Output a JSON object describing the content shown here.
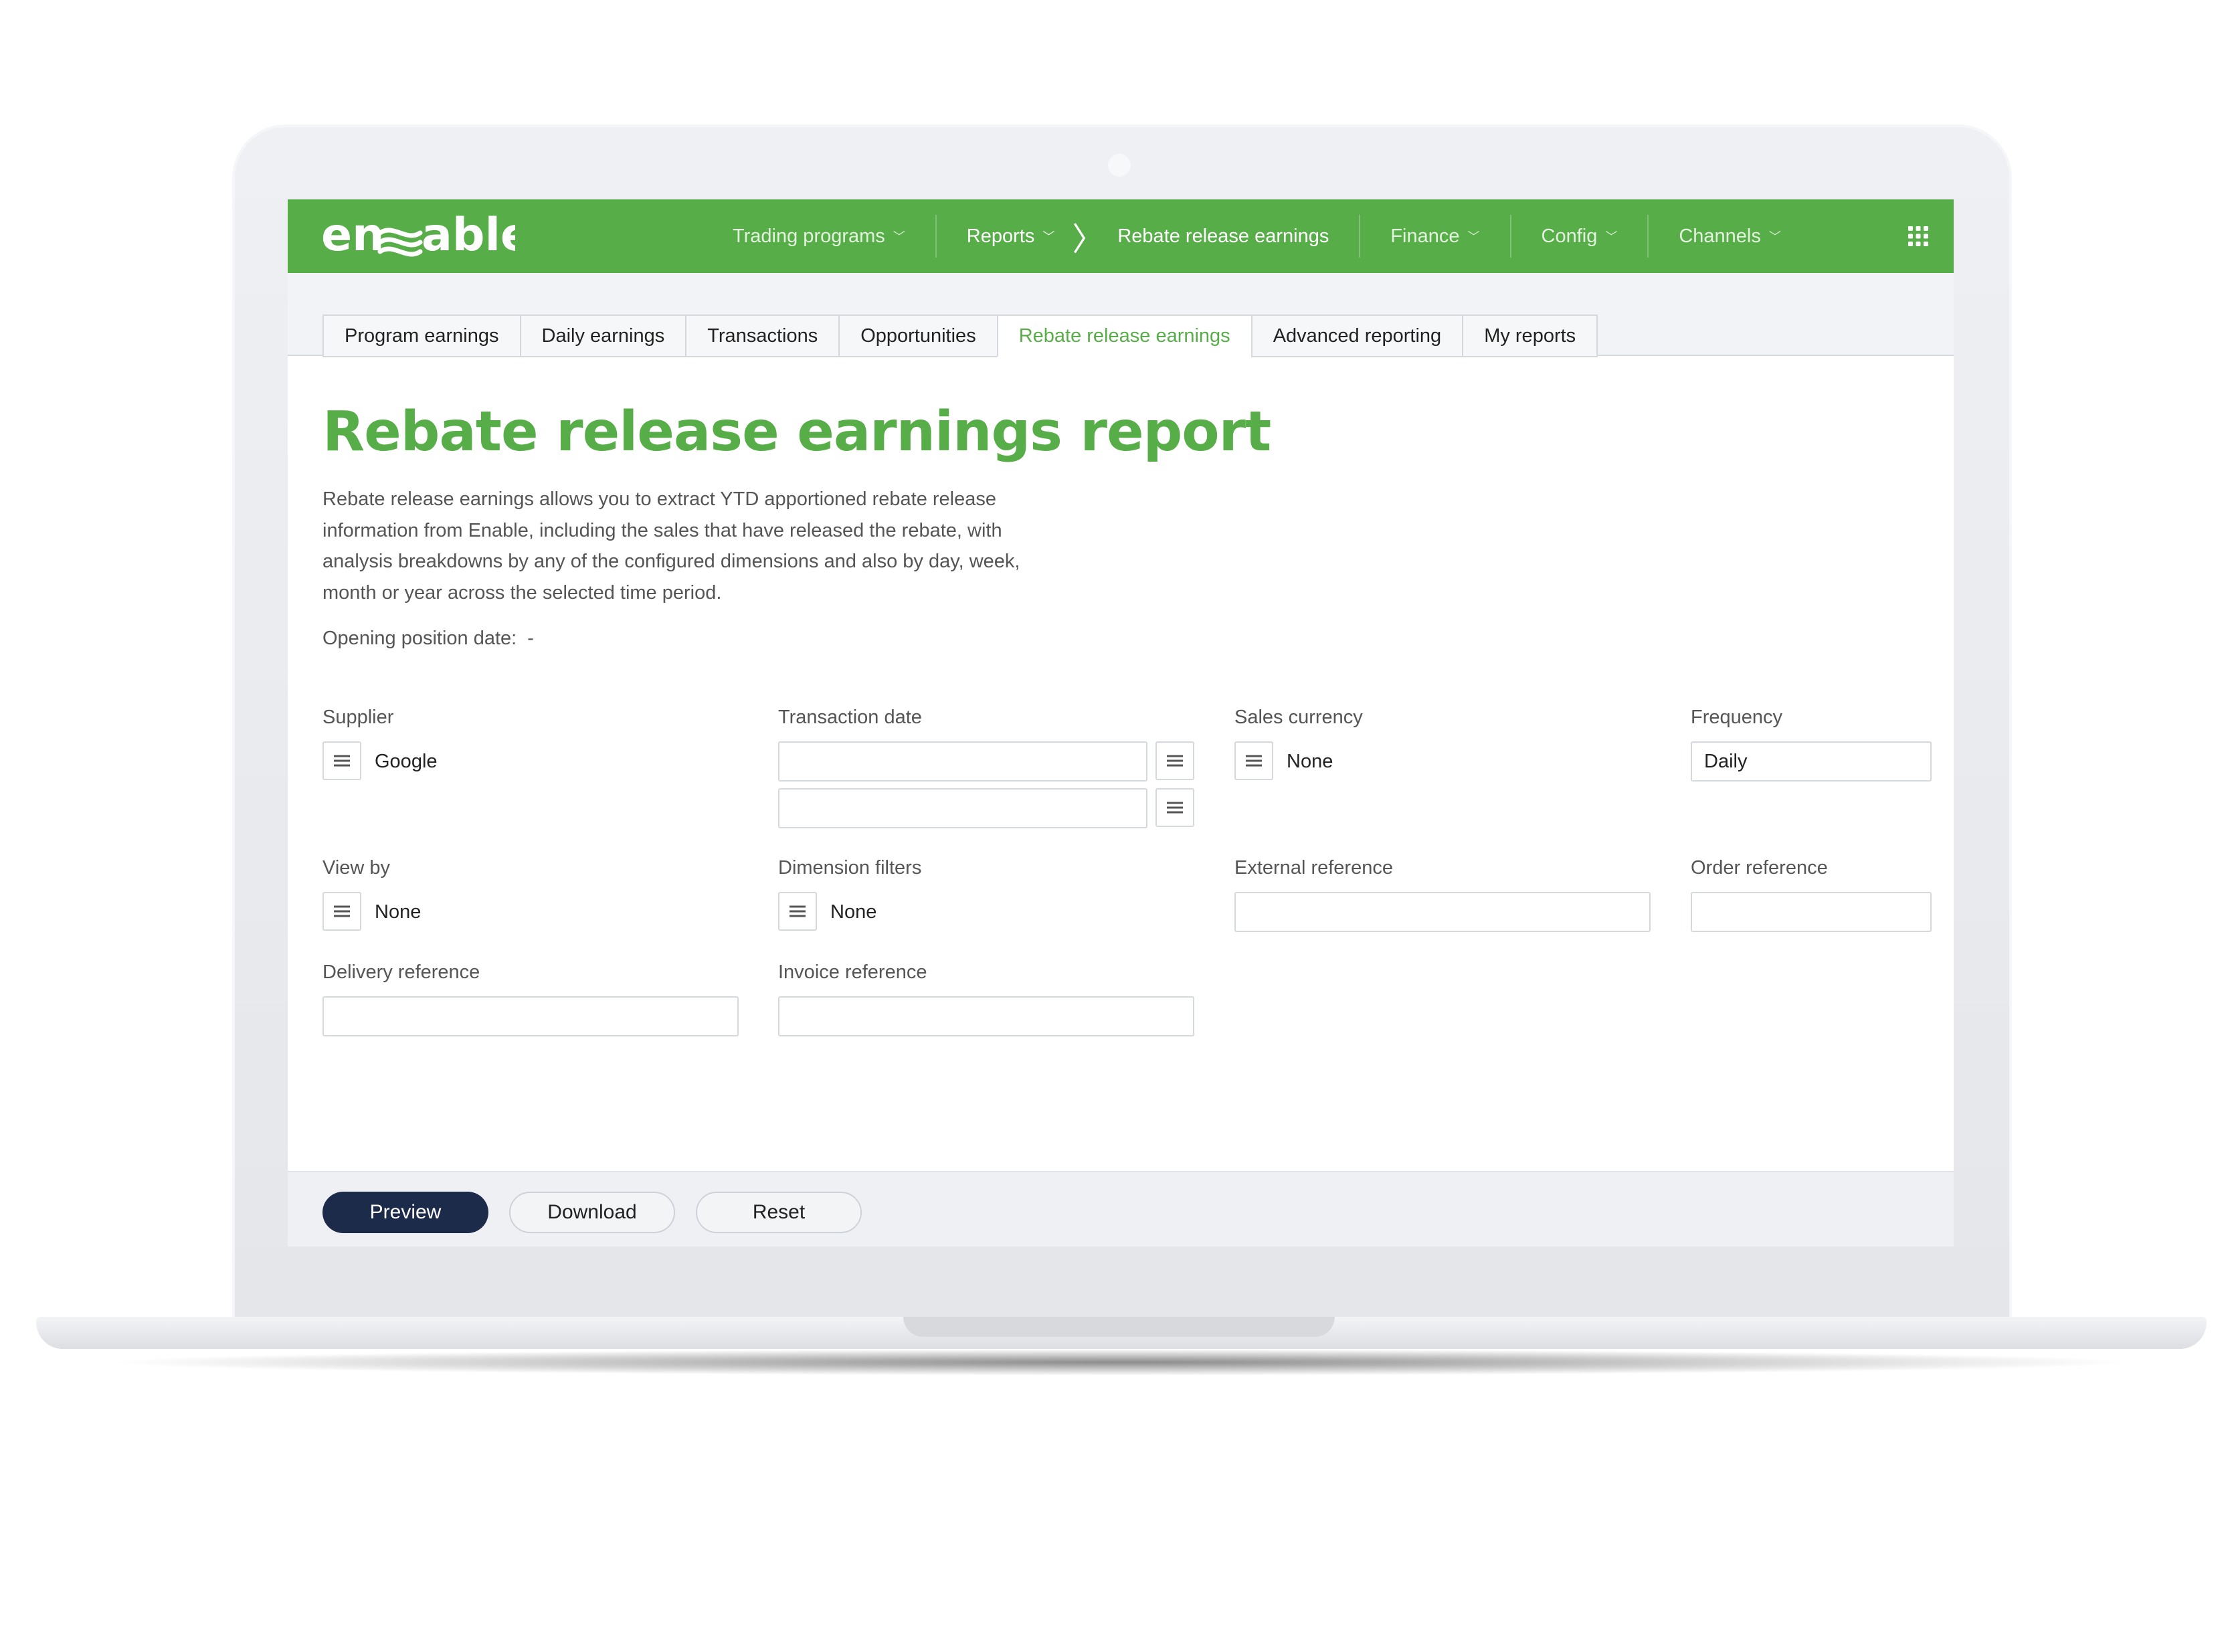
{
  "app": {
    "logo_text": "enable",
    "colors": {
      "brand_green": "#57ad47",
      "primary_button": "#1d2b4a"
    }
  },
  "topnav": {
    "items": [
      {
        "label": "Trading programs",
        "icon": "chevron-down-icon"
      },
      {
        "label": "Reports",
        "icon": "chevron-down-icon"
      },
      {
        "label": "Rebate release earnings"
      },
      {
        "label": "Finance",
        "icon": "chevron-down-icon"
      },
      {
        "label": "Config",
        "icon": "chevron-down-icon"
      },
      {
        "label": "Channels",
        "icon": "chevron-down-icon"
      }
    ],
    "apps_icon": "grid-icon"
  },
  "tabs": [
    {
      "label": "Program earnings"
    },
    {
      "label": "Daily earnings"
    },
    {
      "label": "Transactions"
    },
    {
      "label": "Opportunities"
    },
    {
      "label": "Rebate release earnings",
      "active": true
    },
    {
      "label": "Advanced reporting"
    },
    {
      "label": "My reports"
    }
  ],
  "page": {
    "title": "Rebate release earnings report",
    "description": "Rebate release earnings allows you to extract YTD apportioned rebate release information from Enable, including the sales that have released the rebate, with analysis breakdowns by any of the configured dimensions and also by day, week, month or year across the selected time period.",
    "opening_label": "Opening position date:",
    "opening_value": "-"
  },
  "form": {
    "supplier": {
      "label": "Supplier",
      "value": "Google"
    },
    "transaction_date": {
      "label": "Transaction date",
      "from": "",
      "to": ""
    },
    "sales_currency": {
      "label": "Sales currency",
      "value": "None"
    },
    "frequency": {
      "label": "Frequency",
      "value": "Daily"
    },
    "view_by": {
      "label": "View by",
      "value": "None"
    },
    "dimension_filters": {
      "label": "Dimension filters",
      "value": "None"
    },
    "external_reference": {
      "label": "External reference",
      "value": ""
    },
    "order_reference": {
      "label": "Order reference",
      "value": ""
    },
    "delivery_reference": {
      "label": "Delivery reference",
      "value": ""
    },
    "invoice_reference": {
      "label": "Invoice reference",
      "value": ""
    }
  },
  "footer": {
    "preview_label": "Preview",
    "download_label": "Download",
    "reset_label": "Reset"
  }
}
